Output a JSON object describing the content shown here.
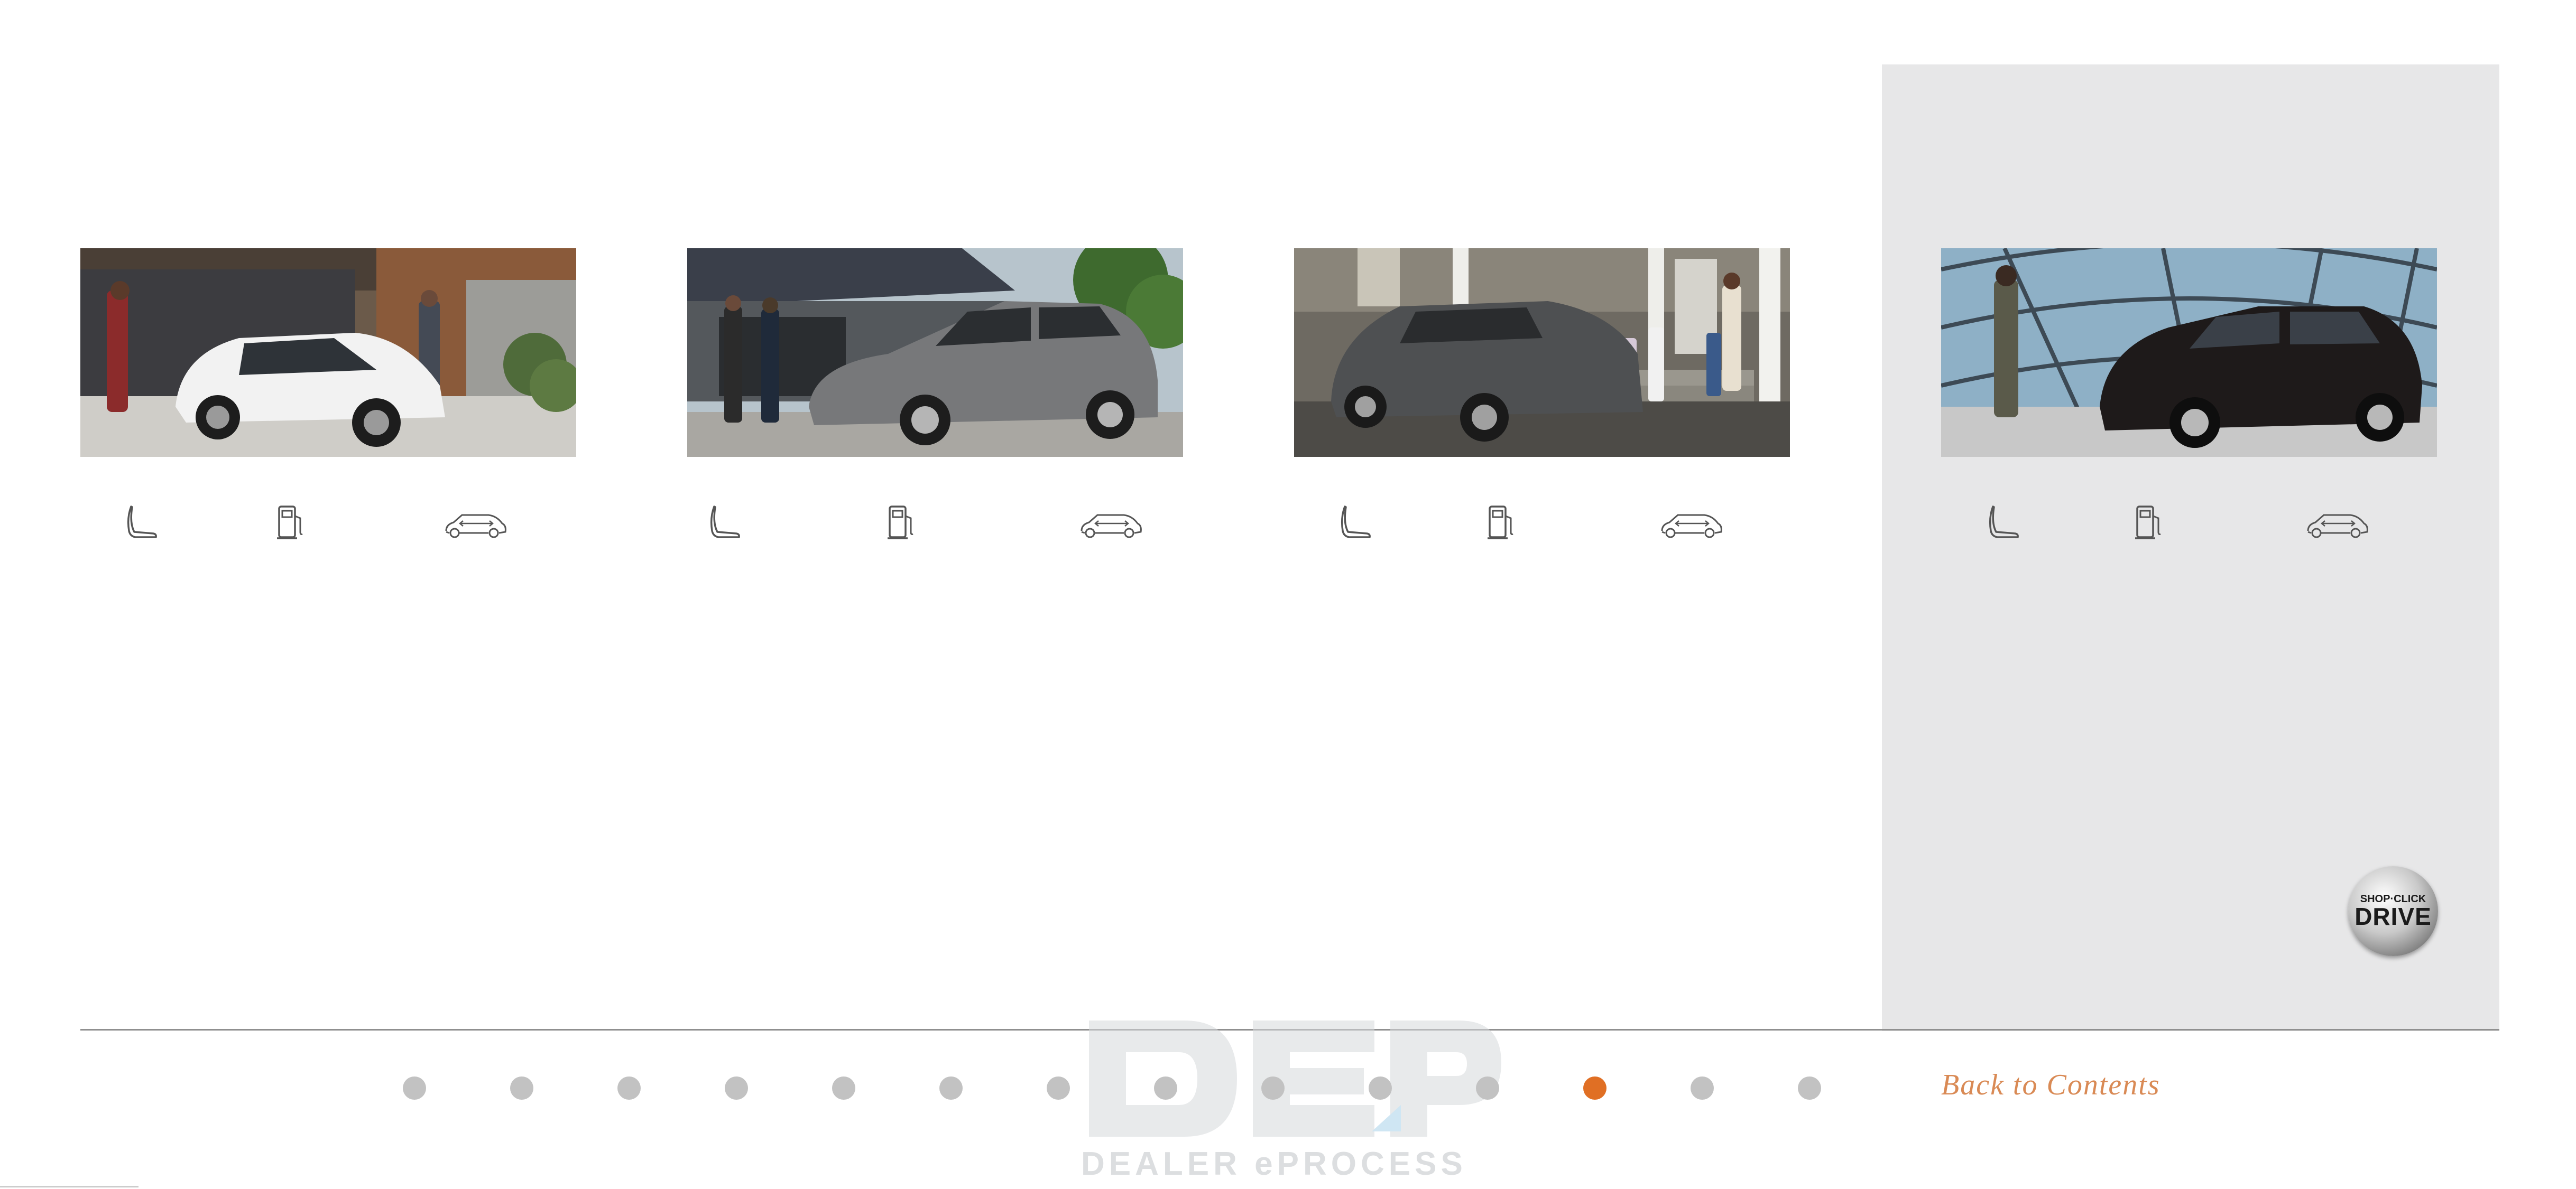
{
  "vehicles": [
    {
      "name": "vehicle-1",
      "paint": "#f2f2f2",
      "scene": "driveway",
      "icons": [
        "seat-icon",
        "fuel-pump-icon",
        "suv-dimensions-icon"
      ]
    },
    {
      "name": "vehicle-2",
      "paint": "#77787a",
      "scene": "modern-house",
      "icons": [
        "seat-icon",
        "fuel-pump-icon",
        "suv-dimensions-icon"
      ]
    },
    {
      "name": "vehicle-3",
      "paint": "#4e5052",
      "scene": "porch",
      "icons": [
        "seat-icon",
        "fuel-pump-icon",
        "suv-dimensions-icon"
      ]
    },
    {
      "name": "vehicle-4",
      "paint": "#1e1a1a",
      "scene": "dome",
      "icons": [
        "seat-icon",
        "fuel-pump-icon",
        "suv-dimensions-icon"
      ]
    }
  ],
  "pagination": {
    "total": 14,
    "active_index": 11,
    "active_color": "#e06f24",
    "inactive_color": "#c2c2c2"
  },
  "navigation": {
    "back_label": "Back to Contents"
  },
  "badge": {
    "top_text": "SHOP·CLICK",
    "main_text": "DRIVE"
  },
  "watermark": {
    "text": "DEALER ePROCESS"
  },
  "colors": {
    "panel": "#e7e7e8",
    "accent": "#e06f24",
    "divider": "#8f8f8f"
  }
}
